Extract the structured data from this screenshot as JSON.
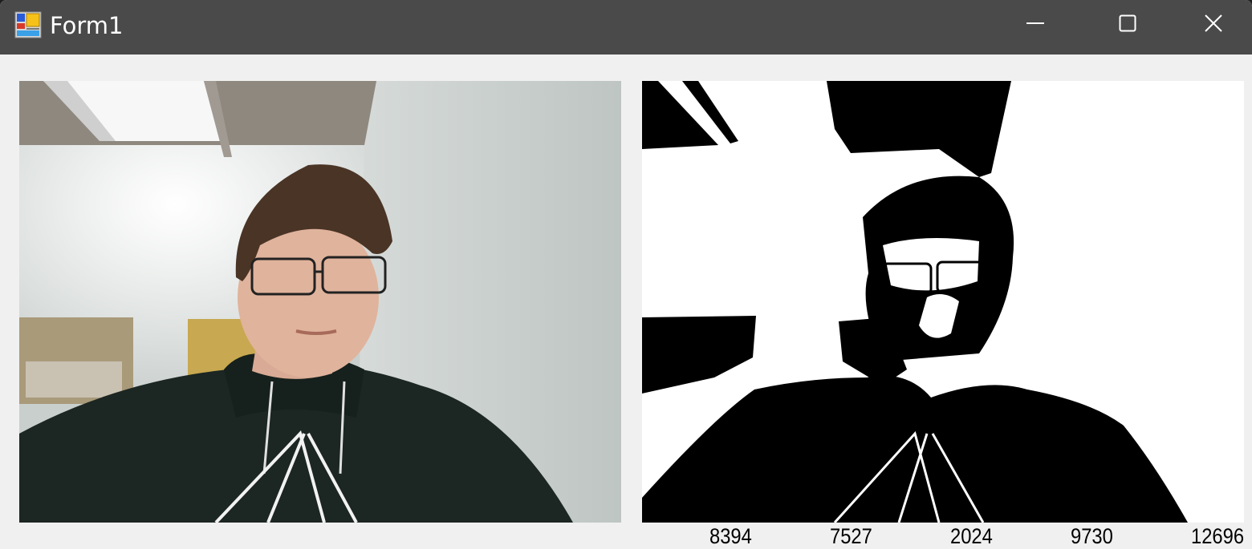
{
  "window": {
    "title": "Form1",
    "icon": "winforms-app-icon",
    "controls": [
      "minimize-icon",
      "maximize-icon",
      "close-icon"
    ]
  },
  "pictures": {
    "camera": "camera-feed-image",
    "threshold": "binary-threshold-image"
  },
  "counts": [
    "8394",
    "7527",
    "2024",
    "9730",
    "12696"
  ]
}
